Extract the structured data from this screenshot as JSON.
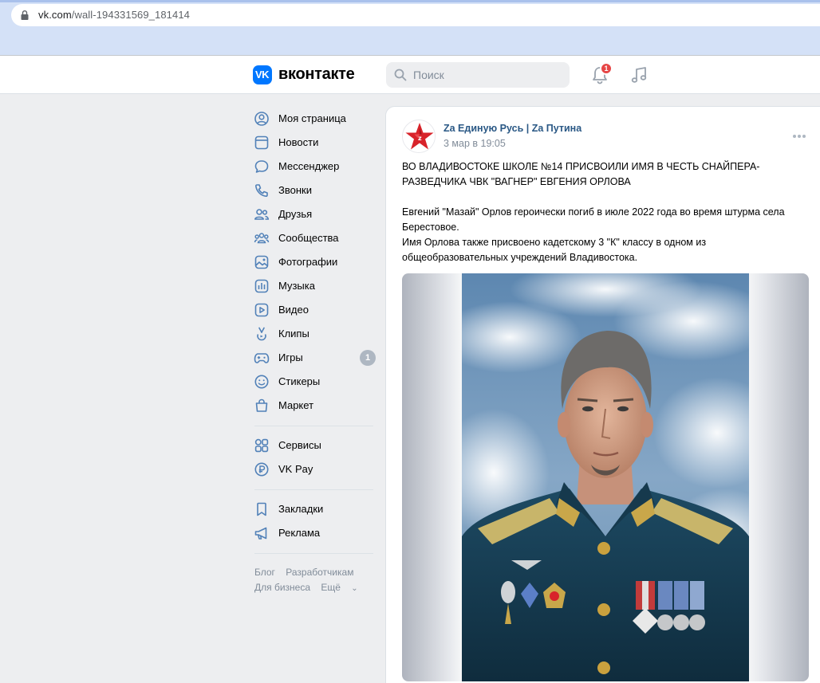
{
  "browser": {
    "url_main": "vk.com",
    "url_path": "/wall-194331569_181414"
  },
  "header": {
    "logo_letters": "VK",
    "wordmark": "вконтакте",
    "search_placeholder": "Поиск",
    "notifications_count": "1"
  },
  "sidebar": {
    "items": [
      {
        "label": "Моя страница",
        "icon": "user-circle-icon"
      },
      {
        "label": "Новости",
        "icon": "news-icon"
      },
      {
        "label": "Мессенджер",
        "icon": "message-icon"
      },
      {
        "label": "Звонки",
        "icon": "phone-icon"
      },
      {
        "label": "Друзья",
        "icon": "friends-icon"
      },
      {
        "label": "Сообщества",
        "icon": "communities-icon"
      },
      {
        "label": "Фотографии",
        "icon": "photo-icon"
      },
      {
        "label": "Музыка",
        "icon": "music-icon"
      },
      {
        "label": "Видео",
        "icon": "video-icon"
      },
      {
        "label": "Клипы",
        "icon": "clips-icon"
      },
      {
        "label": "Игры",
        "icon": "games-icon",
        "count": "1"
      },
      {
        "label": "Стикеры",
        "icon": "sticker-icon"
      },
      {
        "label": "Маркет",
        "icon": "market-icon"
      }
    ],
    "items2": [
      {
        "label": "Сервисы",
        "icon": "services-icon"
      },
      {
        "label": "VK Pay",
        "icon": "vkpay-icon"
      }
    ],
    "items3": [
      {
        "label": "Закладки",
        "icon": "bookmark-icon"
      },
      {
        "label": "Реклама",
        "icon": "megaphone-icon"
      }
    ],
    "footer": {
      "blog": "Блог",
      "developers": "Разработчикам",
      "business": "Для бизнеса",
      "more": "Ещё"
    }
  },
  "post": {
    "group_name": "Za Единую Русь | Za Путина",
    "date": "3 мар в 19:05",
    "headline_line1": "ВО ВЛАДИВОСТОКЕ ШКОЛЕ №14 ПРИСВОИЛИ ИМЯ В ЧЕСТЬ СНАЙПЕРА-",
    "headline_line2": "РАЗВЕДЧИКА ЧВК \"ВАГНЕР\" ЕВГЕНИЯ ОРЛОВА",
    "body_line1": "Евгений \"Мазай\" Орлов героически погиб в июле 2022 года во время штурма села",
    "body_line2": "Берестовое.",
    "body_line3": "Имя Орлова также присвоено кадетскому 3 \"К\" классу в одном из",
    "body_line4": "общеобразовательных учреждений Владивостока."
  },
  "colors": {
    "brand": "#0077ff",
    "link": "#2a5885",
    "badge": "#e64646",
    "avatar_star": "#d8232a"
  }
}
